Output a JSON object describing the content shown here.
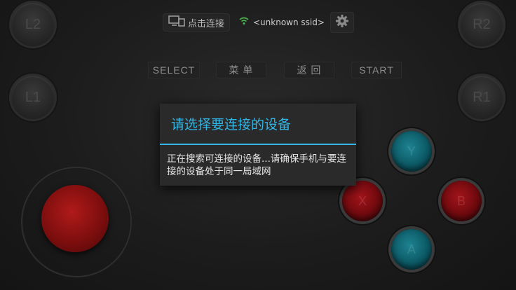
{
  "shoulders": {
    "l2": "L2",
    "r2": "R2",
    "l1": "L1",
    "r1": "R1"
  },
  "topbar": {
    "connect_label": "点击连接",
    "ssid": "<unknown ssid>"
  },
  "buttons": {
    "select": "SELECT",
    "menu": "菜 单",
    "back": "返 回",
    "start": "START"
  },
  "face_buttons": {
    "y": "Y",
    "x": "X",
    "b": "B",
    "a": "A"
  },
  "dialog": {
    "title": "请选择要连接的设备",
    "message": "正在搜索可连接的设备...请确保手机与要连接的设备处于同一局域网"
  },
  "colors": {
    "accent": "#33b5e5",
    "teal": "#0c5a66",
    "red": "#7e0e0e",
    "wifi": "#4caf50"
  }
}
